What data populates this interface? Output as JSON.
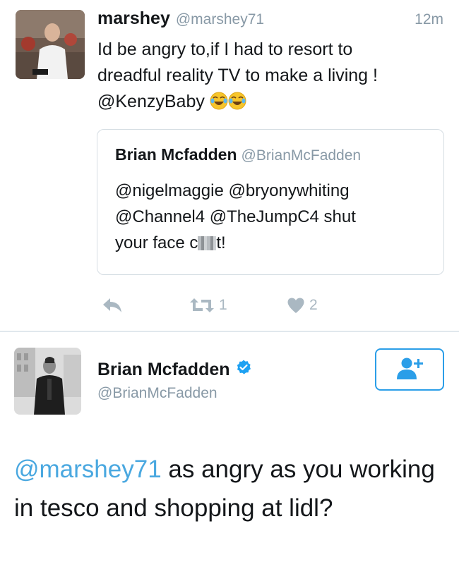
{
  "tweet": {
    "user_name": "marshey",
    "user_handle": "@marshey71",
    "time": "12m",
    "text_line1": "Id be angry to,if I had to resort to",
    "text_line2": "dreadful reality TV to make a living !",
    "text_line3": "@KenzyBaby",
    "emoji": [
      "face-with-tears-of-joy-icon",
      "face-with-tears-of-joy-icon"
    ],
    "quoted": {
      "user_name": "Brian Mcfadden",
      "user_handle": "@BrianMcFadden",
      "line1": "@nigelmaggie @bryonywhiting",
      "line2": "@Channel4 @TheJumpC4 shut",
      "line3_start": "your face c",
      "line3_end": "t!"
    },
    "actions": {
      "retweet_count": "1",
      "like_count": "2"
    }
  },
  "reply": {
    "user_name": "Brian Mcfadden",
    "user_handle": "@BrianMcFadden",
    "verified": true,
    "mention": "@marshey71",
    "text_after_mention": " as angry as you working in tesco and shopping at lidl?"
  },
  "colors": {
    "link": "#4aa8e0",
    "muted": "#8899a6",
    "icon": "#aab8c2",
    "verified": "#1da1f2",
    "follow": "#2b9ee8",
    "border": "#d5dde3"
  }
}
